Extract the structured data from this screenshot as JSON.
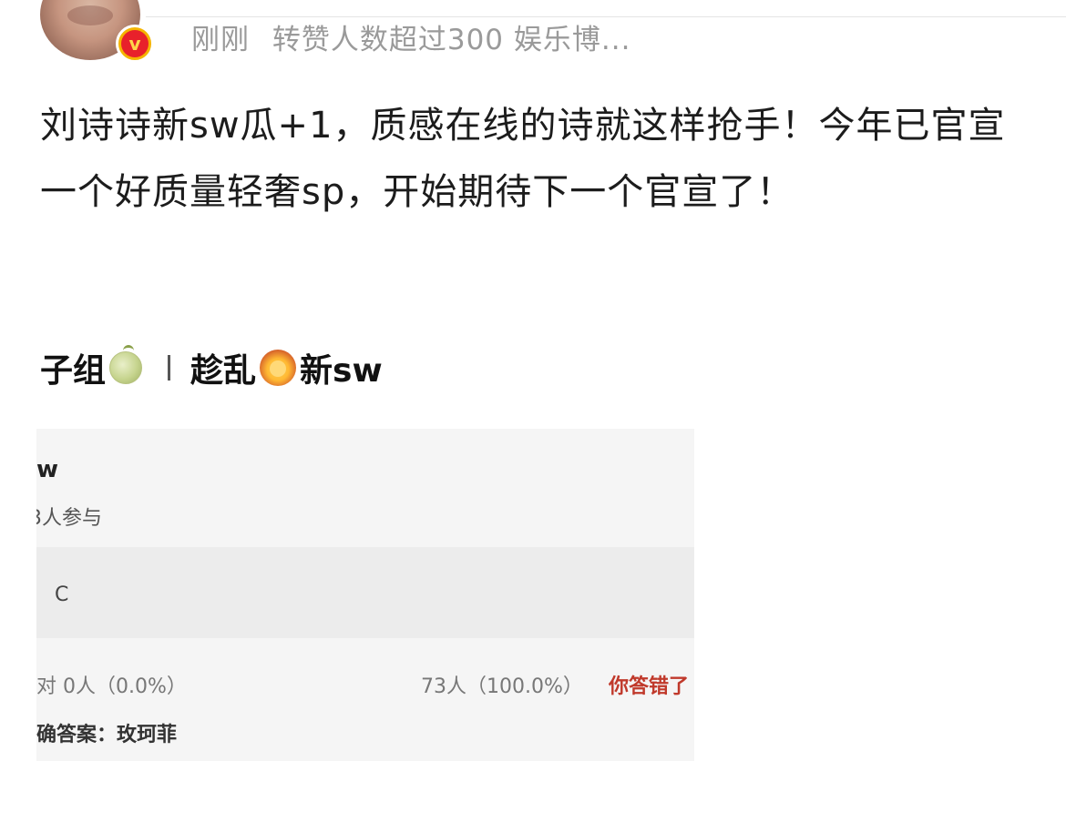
{
  "post": {
    "meta": {
      "time": "刚刚",
      "source": "转赞人数超过300 娱乐博..."
    },
    "text": "刘诗诗新sw瓜+1，质感在线的诗就这样抢手！今年已官宣一个好质量轻奢sp，开始期待下一个官宣了！"
  },
  "embed": {
    "header_left": "子组",
    "header_right": "趁乱",
    "header_tail": "新sw",
    "quiz": {
      "title": "w",
      "participants": "3人参与",
      "option": "C",
      "stat_left": "对 0人（0.0%）",
      "stat_right": "73人（100.0%）",
      "wrong_text": "你答错了",
      "answer": "确答案：玫珂菲"
    }
  },
  "colors": {
    "meta_gray": "#9a9a9a",
    "badge_red": "#e8212b",
    "badge_gold": "#f5b400",
    "wrong_red": "#c0392b"
  },
  "icons": [
    "verified-badge-icon",
    "melon-icon",
    "lion-icon"
  ]
}
